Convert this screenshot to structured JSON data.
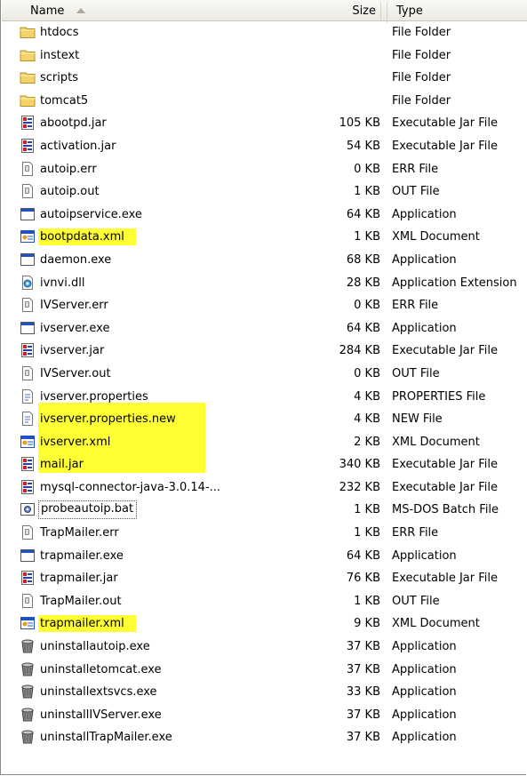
{
  "header": {
    "name": "Name",
    "size": "Size",
    "type": "Type"
  },
  "files": [
    {
      "name": "htdocs",
      "size": "",
      "type": "File Folder",
      "icon": "folder-icon"
    },
    {
      "name": "instext",
      "size": "",
      "type": "File Folder",
      "icon": "folder-icon"
    },
    {
      "name": "scripts",
      "size": "",
      "type": "File Folder",
      "icon": "folder-icon"
    },
    {
      "name": "tomcat5",
      "size": "",
      "type": "File Folder",
      "icon": "folder-icon"
    },
    {
      "name": "abootpd.jar",
      "size": "105 KB",
      "type": "Executable Jar File",
      "icon": "jar-icon"
    },
    {
      "name": "activation.jar",
      "size": "54 KB",
      "type": "Executable Jar File",
      "icon": "jar-icon"
    },
    {
      "name": "autoip.err",
      "size": "0 KB",
      "type": "ERR File",
      "icon": "generic-file-icon"
    },
    {
      "name": "autoip.out",
      "size": "1 KB",
      "type": "OUT File",
      "icon": "generic-file-icon"
    },
    {
      "name": "autoipservice.exe",
      "size": "64 KB",
      "type": "Application",
      "icon": "application-window-icon"
    },
    {
      "name": "bootpdata.xml",
      "size": "1 KB",
      "type": "XML Document",
      "icon": "xml-document-icon",
      "highlight": true
    },
    {
      "name": "daemon.exe",
      "size": "68 KB",
      "type": "Application",
      "icon": "application-window-icon"
    },
    {
      "name": "ivnvi.dll",
      "size": "28 KB",
      "type": "Application Extension",
      "icon": "dll-gear-icon"
    },
    {
      "name": "IVServer.err",
      "size": "0 KB",
      "type": "ERR File",
      "icon": "generic-file-icon"
    },
    {
      "name": "ivserver.exe",
      "size": "64 KB",
      "type": "Application",
      "icon": "application-window-icon"
    },
    {
      "name": "ivserver.jar",
      "size": "284 KB",
      "type": "Executable Jar File",
      "icon": "jar-icon"
    },
    {
      "name": "IVServer.out",
      "size": "0 KB",
      "type": "OUT File",
      "icon": "generic-file-icon"
    },
    {
      "name": "ivserver.properties",
      "size": "4 KB",
      "type": "PROPERTIES File",
      "icon": "properties-file-icon",
      "highlight": true
    },
    {
      "name": "ivserver.properties.new",
      "size": "4 KB",
      "type": "NEW File",
      "icon": "properties-file-icon",
      "highlight": true
    },
    {
      "name": "ivserver.xml",
      "size": "2 KB",
      "type": "XML Document",
      "icon": "xml-document-icon",
      "highlight": true
    },
    {
      "name": "mail.jar",
      "size": "340 KB",
      "type": "Executable Jar File",
      "icon": "jar-icon"
    },
    {
      "name": "mysql-connector-java-3.0.14-...",
      "size": "232 KB",
      "type": "Executable Jar File",
      "icon": "jar-icon"
    },
    {
      "name": "probeautoip.bat",
      "size": "1 KB",
      "type": "MS-DOS Batch File",
      "icon": "batch-file-icon",
      "focus": true
    },
    {
      "name": "TrapMailer.err",
      "size": "1 KB",
      "type": "ERR File",
      "icon": "generic-file-icon"
    },
    {
      "name": "trapmailer.exe",
      "size": "64 KB",
      "type": "Application",
      "icon": "application-window-icon"
    },
    {
      "name": "trapmailer.jar",
      "size": "76 KB",
      "type": "Executable Jar File",
      "icon": "jar-icon"
    },
    {
      "name": "TrapMailer.out",
      "size": "1 KB",
      "type": "OUT File",
      "icon": "generic-file-icon"
    },
    {
      "name": "trapmailer.xml",
      "size": "9 KB",
      "type": "XML Document",
      "icon": "xml-document-icon",
      "highlight": true
    },
    {
      "name": "uninstallautoip.exe",
      "size": "37 KB",
      "type": "Application",
      "icon": "uninstaller-icon"
    },
    {
      "name": "uninstalletomcat.exe",
      "size": "37 KB",
      "type": "Application",
      "icon": "uninstaller-icon"
    },
    {
      "name": "uninstallextsvcs.exe",
      "size": "33 KB",
      "type": "Application",
      "icon": "uninstaller-icon"
    },
    {
      "name": "uninstallIVServer.exe",
      "size": "37 KB",
      "type": "Application",
      "icon": "uninstaller-icon"
    },
    {
      "name": "uninstallTrapMailer.exe",
      "size": "37 KB",
      "type": "Application",
      "icon": "uninstaller-icon"
    }
  ],
  "colors": {
    "highlight": "#ffff33",
    "header_bg": "#ebeae3",
    "folder": "#f3d46c"
  }
}
